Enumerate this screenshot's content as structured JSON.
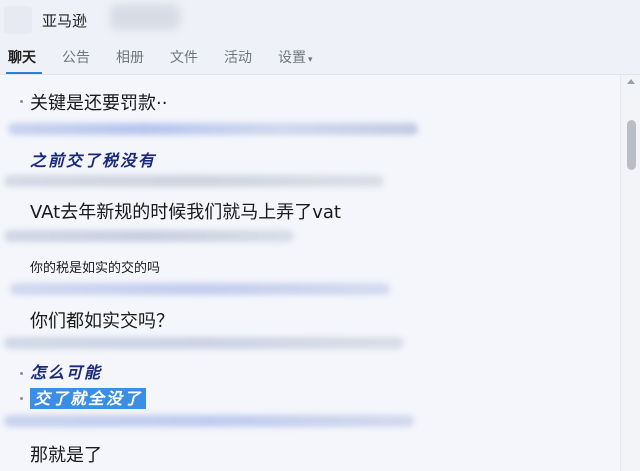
{
  "header": {
    "title": "亚马逊"
  },
  "tabs": [
    {
      "label": "聊天"
    },
    {
      "label": "公告"
    },
    {
      "label": "相册"
    },
    {
      "label": "文件"
    },
    {
      "label": "活动"
    },
    {
      "label": "设置"
    }
  ],
  "tab_caret": "▾",
  "messages": [
    {
      "text": "关键是还要罚款··"
    },
    {
      "text": "之前交了税没有"
    },
    {
      "text": "VAt去年新规的时候我们就马上弄了vat"
    },
    {
      "text": "你的税是如实的交的吗"
    },
    {
      "text": "你们都如实交吗？"
    },
    {
      "text": "怎么可能"
    },
    {
      "text": "交了就全没了"
    },
    {
      "text": "那就是了"
    }
  ],
  "colors": {
    "accent": "#2d7fd3",
    "highlight": "#3a8ee6",
    "calligraphy": "#1b2a7a"
  }
}
